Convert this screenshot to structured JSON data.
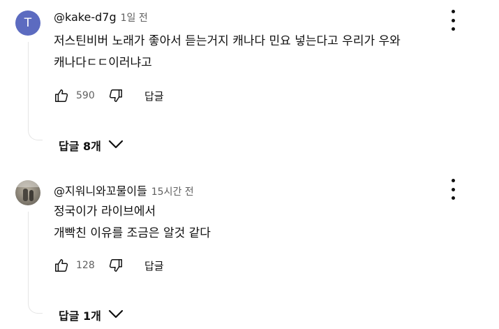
{
  "comments": [
    {
      "avatar_letter": "T",
      "author": "@kake-d7g",
      "time": "1일 전",
      "text_lines": [
        "저스틴비버 노래가 좋아서 듣는거지 캐나다 민요 넣는다고 우리가 우와",
        "캐나다ㄷㄷ이러냐고"
      ],
      "likes": "590",
      "reply_label": "답글",
      "replies_label": "답글 8개"
    },
    {
      "author": "@지워니와꼬물이들",
      "time": "15시간 전",
      "text_lines": [
        "정국이가 라이브에서",
        "개빡친 이유를 조금은 알것 같다"
      ],
      "likes": "128",
      "reply_label": "답글",
      "replies_label": "답글 1개"
    }
  ],
  "icons": {
    "like": "thumbs-up-icon",
    "dislike": "thumbs-down-icon",
    "menu": "more-vert-icon",
    "expand": "chevron-down-icon"
  },
  "colors": {
    "avatar_bg": "#5c6bc0",
    "secondary_text": "#606060"
  }
}
